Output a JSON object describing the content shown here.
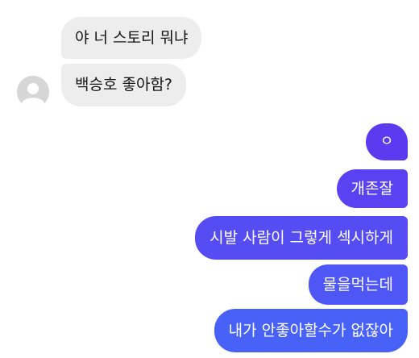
{
  "received": [
    {
      "text": "야 너 스토리 뭐냐"
    },
    {
      "text": "백승호 좋아함?"
    }
  ],
  "sent": [
    {
      "text": "ㅇ"
    },
    {
      "text": "개존잘"
    },
    {
      "text": "시발 사람이 그렇게 섹시하게"
    },
    {
      "text": "물을먹는데"
    },
    {
      "text": "내가 안좋아할수가 없잖아"
    }
  ],
  "colors": {
    "received_bubble": "#ededed",
    "sent_gradient_top": "#5b3af0",
    "sent_gradient_bottom": "#4862f8",
    "background": "#ffffff"
  },
  "icons": {
    "avatar": "default-profile-icon"
  }
}
